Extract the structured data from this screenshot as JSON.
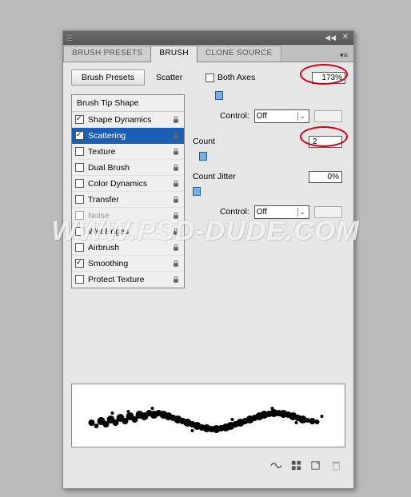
{
  "tabs": {
    "presets": "BRUSH PRESETS",
    "brush": "BRUSH",
    "clone": "CLONE SOURCE"
  },
  "buttons": {
    "brush_presets": "Brush Presets"
  },
  "options_header": "Brush Tip Shape",
  "options": [
    {
      "label": "Shape Dynamics",
      "checked": true,
      "lock": true
    },
    {
      "label": "Scattering",
      "checked": true,
      "lock": true,
      "selected": true
    },
    {
      "label": "Texture",
      "checked": false,
      "lock": true
    },
    {
      "label": "Dual Brush",
      "checked": false,
      "lock": true
    },
    {
      "label": "Color Dynamics",
      "checked": false,
      "lock": true
    },
    {
      "label": "Transfer",
      "checked": false,
      "lock": true
    },
    {
      "label": "Noise",
      "checked": false,
      "lock": true,
      "disabled": true
    },
    {
      "label": "Wet Edges",
      "checked": false,
      "lock": true
    },
    {
      "label": "Airbrush",
      "checked": false,
      "lock": true
    },
    {
      "label": "Smoothing",
      "checked": true,
      "lock": true
    },
    {
      "label": "Protect Texture",
      "checked": false,
      "lock": true
    }
  ],
  "scatter": {
    "label": "Scatter",
    "both_axes_label": "Both Axes",
    "both_axes_checked": false,
    "value": "173%",
    "control_label": "Control:",
    "control_value": "Off"
  },
  "count": {
    "label": "Count",
    "value": "2",
    "jitter_label": "Count Jitter",
    "jitter_value": "0%",
    "control_label": "Control:",
    "control_value": "Off"
  },
  "watermark": "WWW.PSD-DUDE.COM"
}
